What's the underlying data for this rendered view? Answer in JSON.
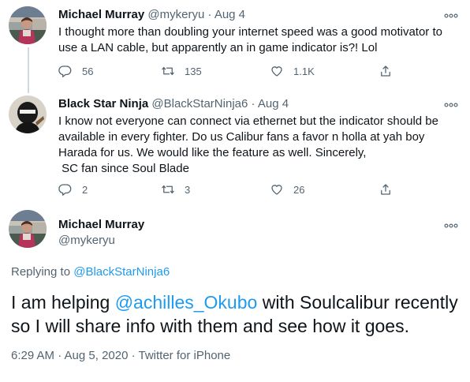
{
  "reply1": {
    "name": "Michael Murray",
    "handle": "@mykeryu",
    "dot": "·",
    "date": "Aug 4",
    "lines": [
      "I thought more than doubling your internet speed was a good motivator to",
      "use a LAN cable, but apparently an in game indicator is?! Lol"
    ],
    "replies": "56",
    "retweets": "135",
    "likes": "1.1K"
  },
  "reply2": {
    "name": "Black Star Ninja",
    "handle": "@BlackStarNinja6",
    "dot": "·",
    "date": "Aug 4",
    "lines": [
      "I know not everyone can connect via ethernet but the indicator should be",
      "available in every fighter. Do us Calibur fans a favor n holla at yah boy",
      "Harada for us. We would like the feature as well. Sincerely,",
      " SC fan since Soul Blade"
    ],
    "replies": "2",
    "retweets": "3",
    "likes": "26"
  },
  "main": {
    "name": "Michael Murray",
    "handle": "@mykeryu",
    "replying_prefix": "Replying to ",
    "replying_to": "@BlackStarNinja6",
    "text_line1_pre": "I am helping ",
    "text_line1_mention": "@achilles_Okubo",
    "text_line1_post": " with Soulcalibur recently",
    "text_line2": "so I will share info with them and see how it goes.",
    "meta": "6:29 AM · Aug 5, 2020 · Twitter for iPhone"
  },
  "icons": {
    "reply": "reply-icon",
    "retweet": "retweet-icon",
    "like": "heart-icon",
    "share": "share-icon",
    "more": "more-icon"
  },
  "colors": {
    "text": "#0f1419",
    "secondary": "#536471",
    "link": "#1d9bf0",
    "thread_line": "#cfd9de"
  }
}
